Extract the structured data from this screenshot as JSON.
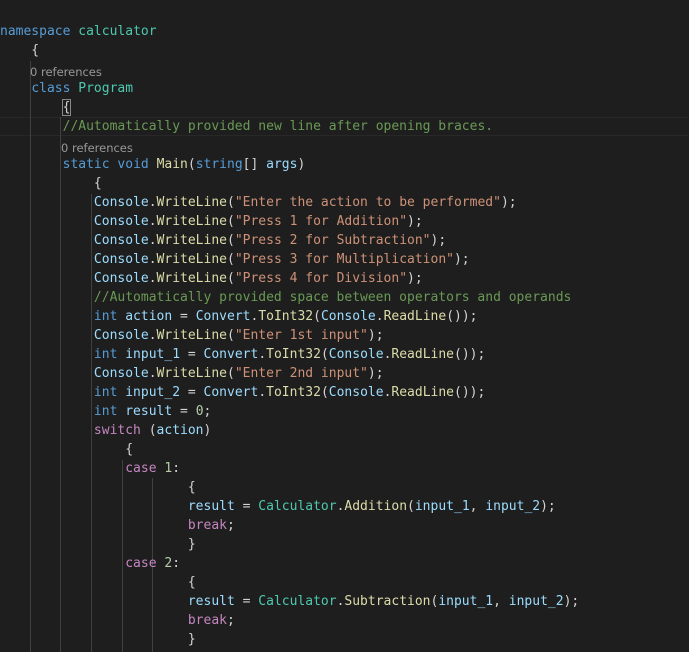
{
  "editor": {
    "theme_colors": {
      "background": "#1e1e1e",
      "keyword": "#569cd6",
      "control": "#c586c0",
      "type": "#4ec9b0",
      "string": "#ce9178",
      "method": "#dcdcaa",
      "variable": "#9cdcfe",
      "number": "#b5cea8",
      "comment": "#6a9955",
      "codelens": "#999999"
    },
    "codelens": {
      "class_refs": "0 references",
      "main_refs": "0 references"
    },
    "lines": [
      {
        "id": "namespace",
        "tokens": [
          {
            "t": "namespace",
            "c": "k"
          },
          {
            "t": " ",
            "c": "p"
          },
          {
            "t": "calculator",
            "c": "t"
          }
        ]
      },
      {
        "id": "ns-open",
        "tokens": [
          {
            "t": "    {",
            "c": "p"
          }
        ]
      },
      {
        "id": "class-decl",
        "tokens": [
          {
            "t": "    ",
            "c": "p"
          },
          {
            "t": "class",
            "c": "k"
          },
          {
            "t": " ",
            "c": "p"
          },
          {
            "t": "Program",
            "c": "t"
          }
        ]
      },
      {
        "id": "class-open",
        "tokens": [
          {
            "t": "        ",
            "c": "p"
          },
          {
            "t": "{",
            "c": "p",
            "box": true
          }
        ]
      },
      {
        "id": "comment-1",
        "tokens": [
          {
            "t": "        ",
            "c": "p"
          },
          {
            "t": "//Automatically provided new line after opening braces.",
            "c": "cm"
          }
        ]
      },
      {
        "id": "main-decl",
        "tokens": [
          {
            "t": "        ",
            "c": "p"
          },
          {
            "t": "static",
            "c": "k"
          },
          {
            "t": " ",
            "c": "p"
          },
          {
            "t": "void",
            "c": "k"
          },
          {
            "t": " ",
            "c": "p"
          },
          {
            "t": "Main",
            "c": "m"
          },
          {
            "t": "(",
            "c": "p"
          },
          {
            "t": "string",
            "c": "k"
          },
          {
            "t": "[] ",
            "c": "p"
          },
          {
            "t": "args",
            "c": "v"
          },
          {
            "t": ")",
            "c": "p"
          }
        ]
      },
      {
        "id": "main-open",
        "tokens": [
          {
            "t": "            {",
            "c": "p"
          }
        ]
      },
      {
        "id": "wl-1",
        "tokens": [
          {
            "t": "            ",
            "c": "p"
          },
          {
            "t": "Console",
            "c": "v"
          },
          {
            "t": ".",
            "c": "p"
          },
          {
            "t": "WriteLine",
            "c": "m"
          },
          {
            "t": "(",
            "c": "p"
          },
          {
            "t": "\"Enter the action to be performed\"",
            "c": "s"
          },
          {
            "t": ");",
            "c": "p"
          }
        ]
      },
      {
        "id": "wl-2",
        "tokens": [
          {
            "t": "            ",
            "c": "p"
          },
          {
            "t": "Console",
            "c": "v"
          },
          {
            "t": ".",
            "c": "p"
          },
          {
            "t": "WriteLine",
            "c": "m"
          },
          {
            "t": "(",
            "c": "p"
          },
          {
            "t": "\"Press 1 for Addition\"",
            "c": "s"
          },
          {
            "t": ");",
            "c": "p"
          }
        ]
      },
      {
        "id": "wl-3",
        "tokens": [
          {
            "t": "            ",
            "c": "p"
          },
          {
            "t": "Console",
            "c": "v"
          },
          {
            "t": ".",
            "c": "p"
          },
          {
            "t": "WriteLine",
            "c": "m"
          },
          {
            "t": "(",
            "c": "p"
          },
          {
            "t": "\"Press 2 for Subtraction\"",
            "c": "s"
          },
          {
            "t": ");",
            "c": "p"
          }
        ]
      },
      {
        "id": "wl-4",
        "tokens": [
          {
            "t": "            ",
            "c": "p"
          },
          {
            "t": "Console",
            "c": "v"
          },
          {
            "t": ".",
            "c": "p"
          },
          {
            "t": "WriteLine",
            "c": "m"
          },
          {
            "t": "(",
            "c": "p"
          },
          {
            "t": "\"Press 3 for Multiplication\"",
            "c": "s"
          },
          {
            "t": ");",
            "c": "p"
          }
        ]
      },
      {
        "id": "wl-5",
        "tokens": [
          {
            "t": "            ",
            "c": "p"
          },
          {
            "t": "Console",
            "c": "v"
          },
          {
            "t": ".",
            "c": "p"
          },
          {
            "t": "WriteLine",
            "c": "m"
          },
          {
            "t": "(",
            "c": "p"
          },
          {
            "t": "\"Press 4 for Division\"",
            "c": "s"
          },
          {
            "t": ");",
            "c": "p"
          }
        ]
      },
      {
        "id": "comment-2",
        "tokens": [
          {
            "t": "            ",
            "c": "p"
          },
          {
            "t": "//Automatically provided space between operators and operands",
            "c": "cm"
          }
        ]
      },
      {
        "id": "int-action",
        "tokens": [
          {
            "t": "            ",
            "c": "p"
          },
          {
            "t": "int",
            "c": "k"
          },
          {
            "t": " ",
            "c": "p"
          },
          {
            "t": "action",
            "c": "v"
          },
          {
            "t": " = ",
            "c": "p"
          },
          {
            "t": "Convert",
            "c": "v"
          },
          {
            "t": ".",
            "c": "p"
          },
          {
            "t": "ToInt32",
            "c": "m"
          },
          {
            "t": "(",
            "c": "p"
          },
          {
            "t": "Console",
            "c": "v"
          },
          {
            "t": ".",
            "c": "p"
          },
          {
            "t": "ReadLine",
            "c": "m"
          },
          {
            "t": "());",
            "c": "p"
          }
        ]
      },
      {
        "id": "wl-6",
        "tokens": [
          {
            "t": "            ",
            "c": "p"
          },
          {
            "t": "Console",
            "c": "v"
          },
          {
            "t": ".",
            "c": "p"
          },
          {
            "t": "WriteLine",
            "c": "m"
          },
          {
            "t": "(",
            "c": "p"
          },
          {
            "t": "\"Enter 1st input\"",
            "c": "s"
          },
          {
            "t": ");",
            "c": "p"
          }
        ]
      },
      {
        "id": "int-input1",
        "tokens": [
          {
            "t": "            ",
            "c": "p"
          },
          {
            "t": "int",
            "c": "k"
          },
          {
            "t": " ",
            "c": "p"
          },
          {
            "t": "input_1",
            "c": "v"
          },
          {
            "t": " = ",
            "c": "p"
          },
          {
            "t": "Convert",
            "c": "v"
          },
          {
            "t": ".",
            "c": "p"
          },
          {
            "t": "ToInt32",
            "c": "m"
          },
          {
            "t": "(",
            "c": "p"
          },
          {
            "t": "Console",
            "c": "v"
          },
          {
            "t": ".",
            "c": "p"
          },
          {
            "t": "ReadLine",
            "c": "m"
          },
          {
            "t": "());",
            "c": "p"
          }
        ]
      },
      {
        "id": "wl-7",
        "tokens": [
          {
            "t": "            ",
            "c": "p"
          },
          {
            "t": "Console",
            "c": "v"
          },
          {
            "t": ".",
            "c": "p"
          },
          {
            "t": "WriteLine",
            "c": "m"
          },
          {
            "t": "(",
            "c": "p"
          },
          {
            "t": "\"Enter 2nd input\"",
            "c": "s"
          },
          {
            "t": ");",
            "c": "p"
          }
        ]
      },
      {
        "id": "int-input2",
        "tokens": [
          {
            "t": "            ",
            "c": "p"
          },
          {
            "t": "int",
            "c": "k"
          },
          {
            "t": " ",
            "c": "p"
          },
          {
            "t": "input_2",
            "c": "v"
          },
          {
            "t": " = ",
            "c": "p"
          },
          {
            "t": "Convert",
            "c": "v"
          },
          {
            "t": ".",
            "c": "p"
          },
          {
            "t": "ToInt32",
            "c": "m"
          },
          {
            "t": "(",
            "c": "p"
          },
          {
            "t": "Console",
            "c": "v"
          },
          {
            "t": ".",
            "c": "p"
          },
          {
            "t": "ReadLine",
            "c": "m"
          },
          {
            "t": "());",
            "c": "p"
          }
        ]
      },
      {
        "id": "int-result",
        "tokens": [
          {
            "t": "            ",
            "c": "p"
          },
          {
            "t": "int",
            "c": "k"
          },
          {
            "t": " ",
            "c": "p"
          },
          {
            "t": "result",
            "c": "v"
          },
          {
            "t": " = ",
            "c": "p"
          },
          {
            "t": "0",
            "c": "n"
          },
          {
            "t": ";",
            "c": "p"
          }
        ]
      },
      {
        "id": "switch",
        "tokens": [
          {
            "t": "            ",
            "c": "p"
          },
          {
            "t": "switch",
            "c": "c"
          },
          {
            "t": " (",
            "c": "p"
          },
          {
            "t": "action",
            "c": "v"
          },
          {
            "t": ")",
            "c": "p"
          }
        ]
      },
      {
        "id": "switch-open",
        "tokens": [
          {
            "t": "                {",
            "c": "p"
          }
        ]
      },
      {
        "id": "case-1",
        "tokens": [
          {
            "t": "                ",
            "c": "p"
          },
          {
            "t": "case",
            "c": "c"
          },
          {
            "t": " ",
            "c": "p"
          },
          {
            "t": "1",
            "c": "n"
          },
          {
            "t": ":",
            "c": "p"
          }
        ]
      },
      {
        "id": "case1-open",
        "tokens": [
          {
            "t": "                        {",
            "c": "p"
          }
        ]
      },
      {
        "id": "add-call",
        "tokens": [
          {
            "t": "                        ",
            "c": "p"
          },
          {
            "t": "result",
            "c": "v"
          },
          {
            "t": " = ",
            "c": "p"
          },
          {
            "t": "Calculator",
            "c": "t"
          },
          {
            "t": ".",
            "c": "p"
          },
          {
            "t": "Addition",
            "c": "m"
          },
          {
            "t": "(",
            "c": "p"
          },
          {
            "t": "input_1",
            "c": "v"
          },
          {
            "t": ", ",
            "c": "p"
          },
          {
            "t": "input_2",
            "c": "v"
          },
          {
            "t": ");",
            "c": "p"
          }
        ]
      },
      {
        "id": "break-1",
        "tokens": [
          {
            "t": "                        ",
            "c": "p"
          },
          {
            "t": "break",
            "c": "c"
          },
          {
            "t": ";",
            "c": "p"
          }
        ]
      },
      {
        "id": "case1-close",
        "tokens": [
          {
            "t": "                        }",
            "c": "p"
          }
        ]
      },
      {
        "id": "case-2",
        "tokens": [
          {
            "t": "                ",
            "c": "p"
          },
          {
            "t": "case",
            "c": "c"
          },
          {
            "t": " ",
            "c": "p"
          },
          {
            "t": "2",
            "c": "n"
          },
          {
            "t": ":",
            "c": "p"
          }
        ]
      },
      {
        "id": "case2-open",
        "tokens": [
          {
            "t": "                        {",
            "c": "p"
          }
        ]
      },
      {
        "id": "sub-call",
        "tokens": [
          {
            "t": "                        ",
            "c": "p"
          },
          {
            "t": "result",
            "c": "v"
          },
          {
            "t": " = ",
            "c": "p"
          },
          {
            "t": "Calculator",
            "c": "t"
          },
          {
            "t": ".",
            "c": "p"
          },
          {
            "t": "Subtraction",
            "c": "m"
          },
          {
            "t": "(",
            "c": "p"
          },
          {
            "t": "input_1",
            "c": "v"
          },
          {
            "t": ", ",
            "c": "p"
          },
          {
            "t": "input_2",
            "c": "v"
          },
          {
            "t": ");",
            "c": "p"
          }
        ]
      },
      {
        "id": "break-2",
        "tokens": [
          {
            "t": "                        ",
            "c": "p"
          },
          {
            "t": "break",
            "c": "c"
          },
          {
            "t": ";",
            "c": "p"
          }
        ]
      },
      {
        "id": "case2-close",
        "tokens": [
          {
            "t": "                        }",
            "c": "p"
          }
        ]
      }
    ]
  }
}
